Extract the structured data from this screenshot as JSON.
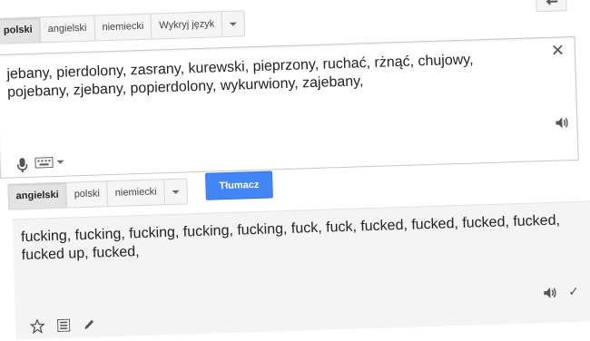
{
  "source_langs": [
    {
      "label": "polski",
      "active": true
    },
    {
      "label": "angielski",
      "active": false
    },
    {
      "label": "niemiecki",
      "active": false
    },
    {
      "label": "Wykryj język",
      "active": false
    }
  ],
  "target_langs": [
    {
      "label": "angielski",
      "active": true
    },
    {
      "label": "polski",
      "active": false
    },
    {
      "label": "niemiecki",
      "active": false
    }
  ],
  "source": {
    "text": "jebany, pierdolony, zasrany, kurewski, pieprzony, ruchać, rżnąć, chujowy, pojebany, zjebany, popierdolony, wykurwiony, zajebany,",
    "clear_glyph": "✕"
  },
  "translate_button": "Tłumacz",
  "result": {
    "text": "fucking, fucking, fucking, fucking, fucking, fuck, fuck, fucked, fucked, fucked, fucked, fucked up, fucked,",
    "check_glyph": "✓"
  },
  "icons": [
    "swap-languages-icon",
    "microphone-icon",
    "keyboard-icon",
    "speaker-icon",
    "star-icon",
    "list-icon",
    "pencil-icon"
  ]
}
